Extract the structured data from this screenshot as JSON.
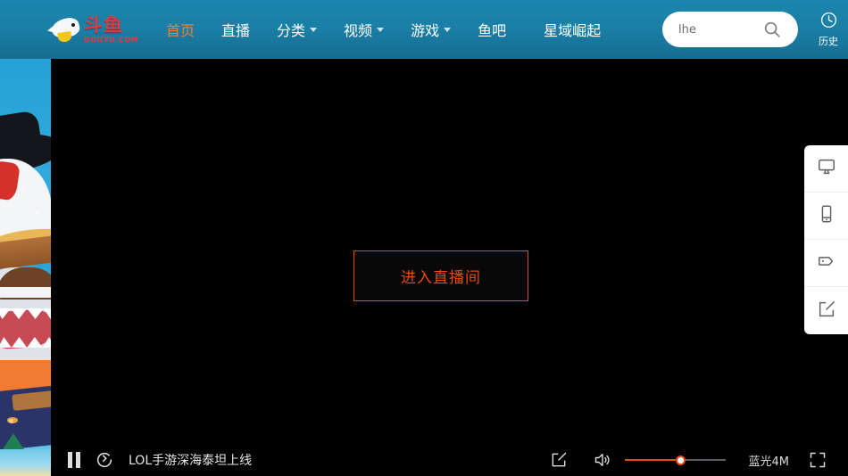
{
  "brand": {
    "logo_cn": "斗鱼",
    "logo_en": "DOUYU.COM",
    "logo_icon": "douyu-fish-logo"
  },
  "nav": {
    "items": [
      {
        "label": "首页",
        "active": true,
        "has_caret": false,
        "name": "nav-item-home"
      },
      {
        "label": "直播",
        "active": false,
        "has_caret": false,
        "name": "nav-item-live"
      },
      {
        "label": "分类",
        "active": false,
        "has_caret": true,
        "name": "nav-item-category"
      },
      {
        "label": "视频",
        "active": false,
        "has_caret": true,
        "name": "nav-item-video"
      },
      {
        "label": "游戏",
        "active": false,
        "has_caret": true,
        "name": "nav-item-game"
      },
      {
        "label": "鱼吧",
        "active": false,
        "has_caret": false,
        "name": "nav-item-fish-bar"
      },
      {
        "label": "星域崛起",
        "active": false,
        "has_caret": false,
        "name": "nav-item-xingyu"
      }
    ]
  },
  "search": {
    "value": "lhe",
    "placeholder": "lhe",
    "icon": "search-icon"
  },
  "history": {
    "label": "历史",
    "icon": "clock-icon"
  },
  "player": {
    "enter_button_label": "进入直播间",
    "controls": {
      "pause_icon": "pause-icon",
      "reload_icon": "reload-icon",
      "title": "LOL手游深海泰坦上线",
      "snapshot_icon": "snapshot-icon",
      "volume_icon": "volume-on-icon",
      "volume_percent": 55,
      "quality_label": "蓝光4M",
      "fullscreen_icon": "fullscreen-icon"
    }
  },
  "tool_panel": {
    "items": [
      {
        "icon": "desktop-icon",
        "name": "tool-desktop"
      },
      {
        "icon": "mobile-icon",
        "name": "tool-mobile"
      },
      {
        "icon": "tag-icon",
        "name": "tool-tag"
      },
      {
        "icon": "compose-icon",
        "name": "tool-compose"
      }
    ]
  },
  "colors": {
    "nav_bg": "#1b7fa6",
    "accent_orange": "#ff7d28",
    "player_accent": "#e8490f",
    "brand_red": "#e4393c"
  }
}
